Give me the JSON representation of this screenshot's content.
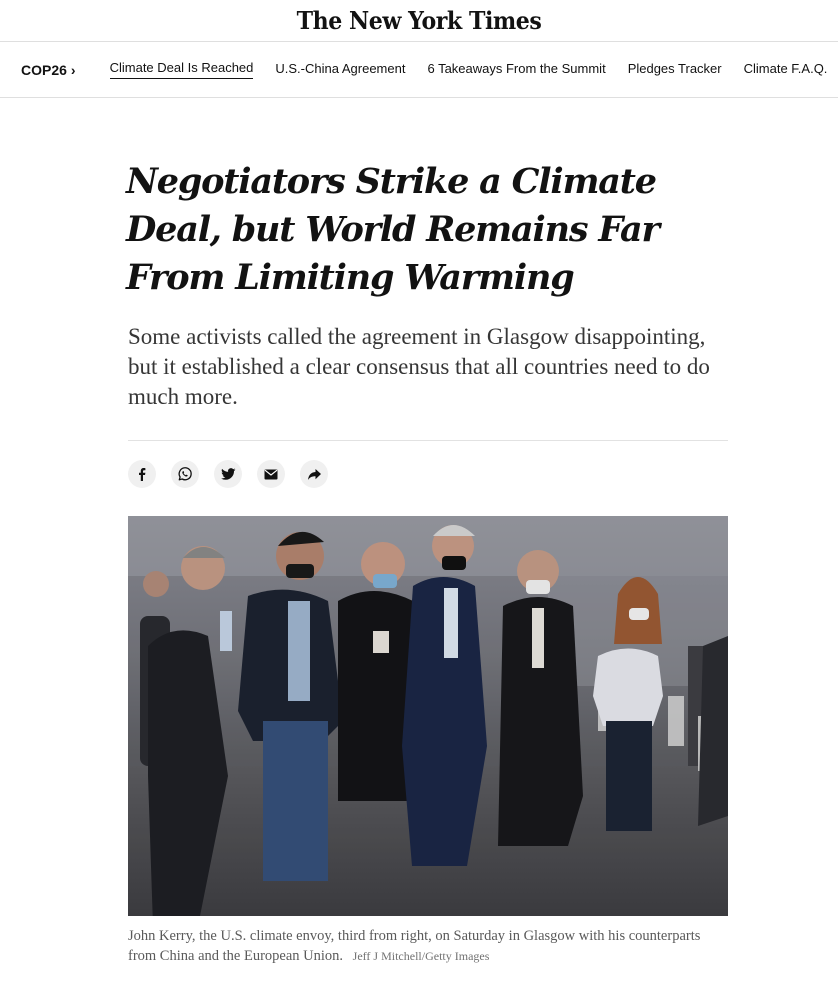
{
  "masthead": {
    "logo": "The New York Times"
  },
  "subnav": {
    "section": "COP26",
    "chevron": "›",
    "links": [
      {
        "label": "Climate Deal Is Reached",
        "active": true
      },
      {
        "label": "U.S.-China Agreement"
      },
      {
        "label": "6 Takeaways From the Summit"
      },
      {
        "label": "Pledges Tracker"
      },
      {
        "label": "Climate F.A.Q."
      }
    ]
  },
  "article": {
    "headline": "Negotiators Strike a Climate Deal, but World Remains Far From Limiting Warming",
    "summary": "Some activists called the agreement in Glasgow disappointing, but it established a clear consensus that all countries need to do much more.",
    "share_icons": [
      "facebook-icon",
      "whatsapp-icon",
      "twitter-icon",
      "email-icon",
      "share-icon"
    ]
  },
  "photo": {
    "caption": "John Kerry, the U.S. climate envoy, third from right, on Saturday in Glasgow with his counterparts from China and the European Union.",
    "credit": "Jeff J Mitchell/Getty Images"
  },
  "colors": {
    "text": "#121212",
    "summary": "#363636",
    "caption": "#5a5a5a",
    "divider": "#dfdfdf",
    "share_bg": "#f0f0f0"
  }
}
